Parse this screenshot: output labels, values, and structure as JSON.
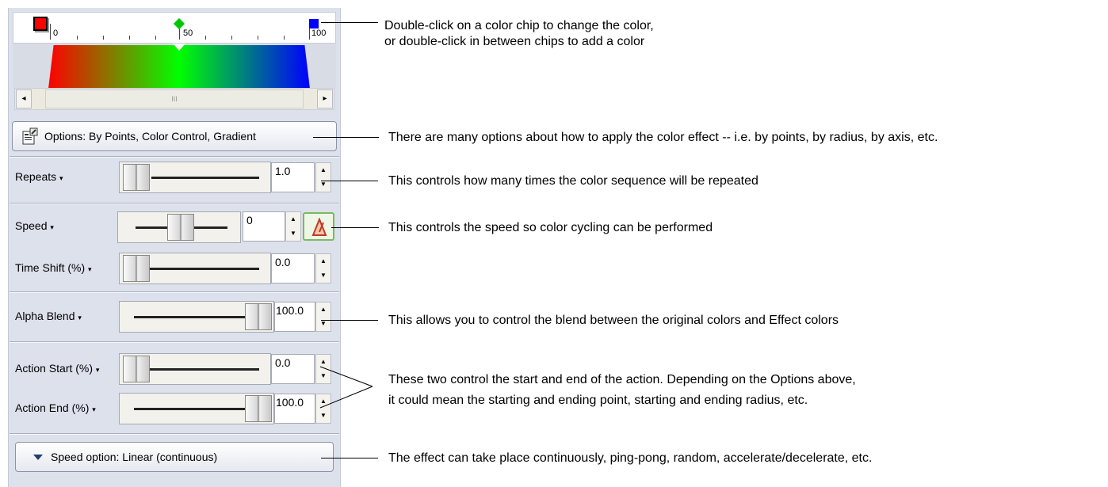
{
  "gradient_editor": {
    "ruler_labels": [
      "0",
      "50",
      "100"
    ],
    "scroll_thumb_grip": "III",
    "scroll_left": "◂",
    "scroll_right": "▸",
    "chip_colors": [
      "#ff0000",
      "#00c800",
      "#0000ff"
    ]
  },
  "options_button": {
    "label": "Options: By Points, Color Control, Gradient"
  },
  "controls": {
    "repeats": {
      "label": "Repeats",
      "value": "1.0"
    },
    "speed": {
      "label": "Speed",
      "value": "0"
    },
    "time_shift": {
      "label": "Time Shift (%)",
      "value": "0.0"
    },
    "alpha_blend": {
      "label": "Alpha Blend",
      "value": "100.0"
    },
    "action_start": {
      "label": "Action Start (%)",
      "value": "0.0"
    },
    "action_end": {
      "label": "Action End (%)",
      "value": "100.0"
    }
  },
  "speed_option_button": {
    "label": "Speed option: Linear (continuous)"
  },
  "spin_up": "▲",
  "spin_down": "▼",
  "dropdown_caret": "▾",
  "annotations": {
    "chip_line1": "Double-click on a color chip to change the color,",
    "chip_line2": "or double-click in between chips to add a color",
    "options": "There are many options about how to apply the color effect -- i.e. by points, by radius, by axis, etc.",
    "repeats": "This controls how many times the color sequence will be repeated",
    "speed": "This controls the speed so color cycling can be performed",
    "alpha": "This allows you to control the blend between the original colors and Effect colors",
    "action_line1": "These two control the start and end of the action. Depending on the Options above,",
    "action_line2": "it could mean the starting and ending point, starting and ending radius, etc.",
    "speed_option": "The effect can take place continuously, ping-pong, random, accelerate/decelerate, etc."
  }
}
